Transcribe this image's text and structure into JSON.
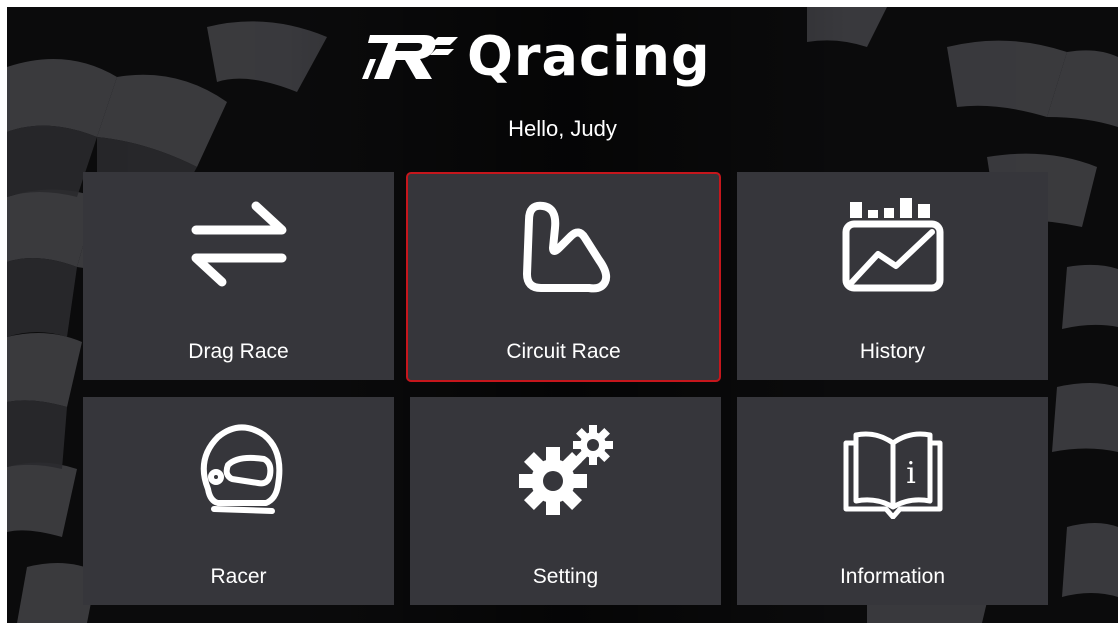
{
  "app": {
    "logo_text": "Qracing",
    "greeting": "Hello, Judy"
  },
  "menu": {
    "tiles": [
      {
        "id": "drag",
        "label": "Drag Race",
        "icon": "arrows-swap-icon"
      },
      {
        "id": "circuit",
        "label": "Circuit Race",
        "icon": "race-track-icon",
        "selected": true
      },
      {
        "id": "history",
        "label": "History",
        "icon": "history-chart-icon"
      },
      {
        "id": "racer",
        "label": "Racer",
        "icon": "helmet-icon"
      },
      {
        "id": "setting",
        "label": "Setting",
        "icon": "gears-icon"
      },
      {
        "id": "info",
        "label": "Information",
        "icon": "info-book-icon"
      }
    ]
  },
  "colors": {
    "background": "#0b0b0c",
    "tile": "#36363b",
    "selected_border": "#c6161c",
    "text": "#ffffff"
  }
}
